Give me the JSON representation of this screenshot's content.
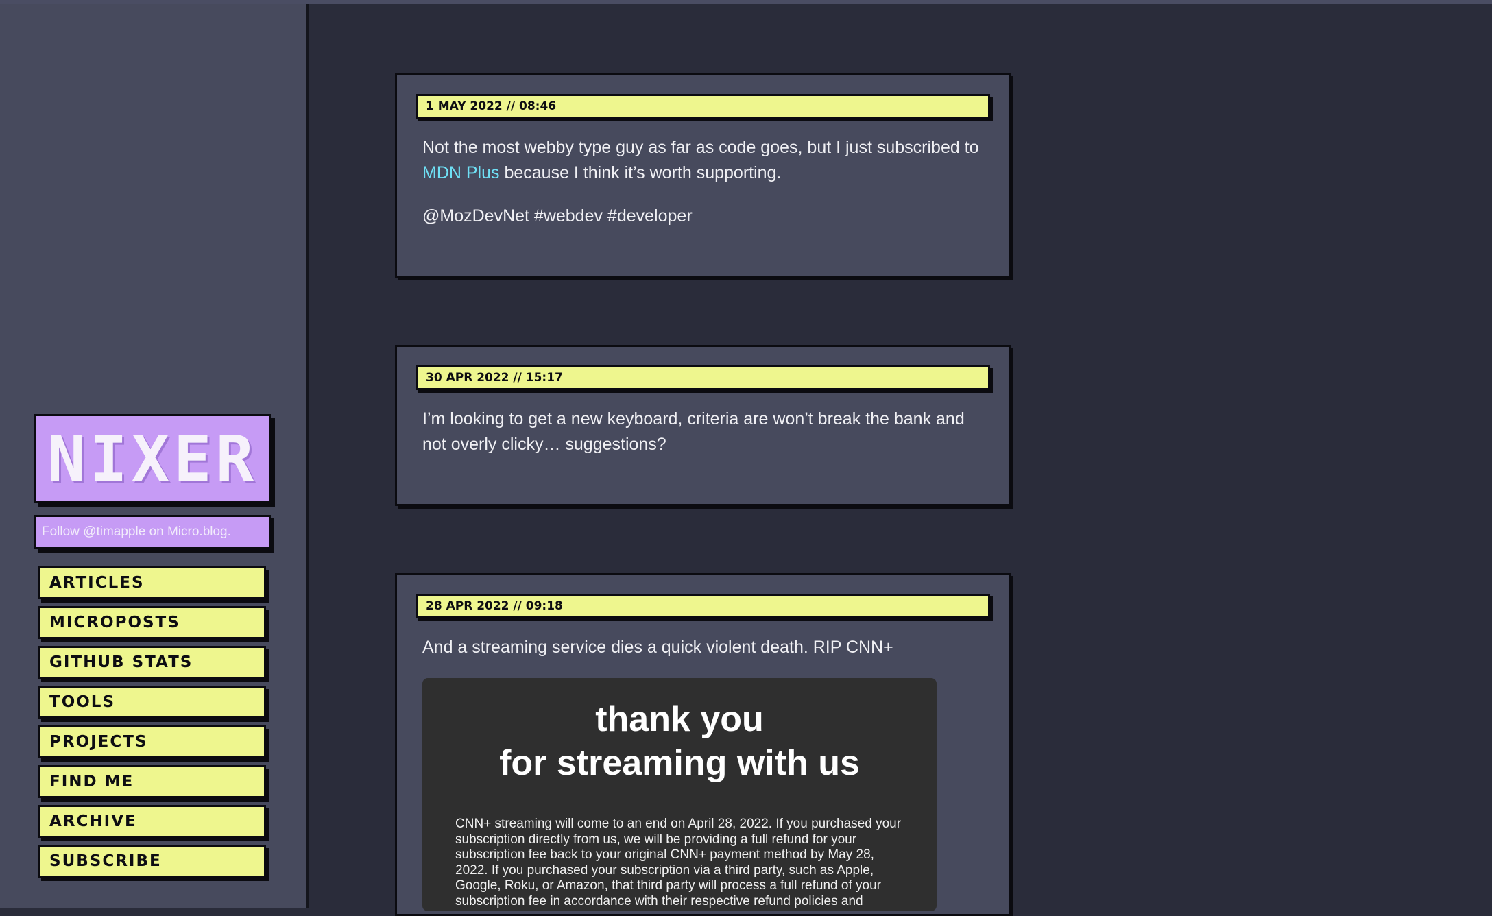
{
  "site": {
    "logo": "NIXER",
    "follow_text": "Follow @timapple on Micro.blog."
  },
  "nav": {
    "items": [
      {
        "label": "ARTICLES"
      },
      {
        "label": "MICROPOSTS"
      },
      {
        "label": "GITHUB STATS"
      },
      {
        "label": "TOOLS"
      },
      {
        "label": "PROJECTS"
      },
      {
        "label": "FIND ME"
      },
      {
        "label": "ARCHIVE"
      },
      {
        "label": "SUBSCRIBE"
      }
    ]
  },
  "posts": [
    {
      "date": "1 MAY 2022 // 08:46",
      "text_before": "Not the most webby type guy as far as code goes, but I just subscribed to ",
      "link": "MDN Plus",
      "text_after": " because I think it’s worth supporting.",
      "tags": "@MozDevNet #webdev #developer"
    },
    {
      "date": "30 APR 2022 // 15:17",
      "text": "I’m looking to get a new keyboard, criteria are won’t break the bank and not overly clicky… suggestions?"
    },
    {
      "date": "28 APR 2022 // 09:18",
      "text": "And a streaming service dies a quick violent death. RIP CNN+",
      "embed": {
        "title_line1": "thank you",
        "title_line2": "for streaming with us",
        "body": "CNN+ streaming will come to an end on April 28, 2022. If you purchased your subscription directly from us, we will be providing a full refund for your subscription fee back to your original CNN+ payment method by May 28, 2022. If you purchased your subscription via a third party, such as Apple, Google, Roku, or Amazon, that third party will process a full refund of your subscription fee in accordance with their respective refund policies and"
      }
    }
  ]
}
